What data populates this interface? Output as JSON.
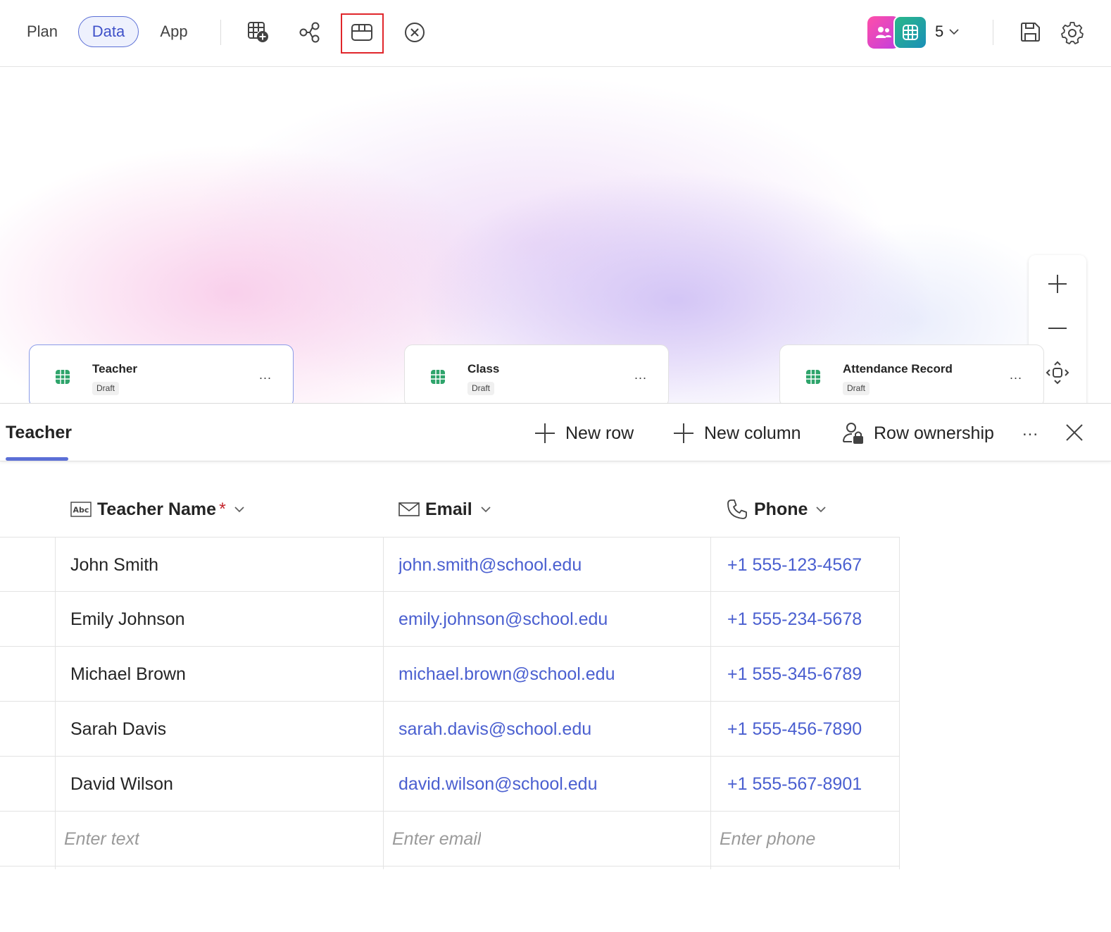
{
  "nav": {
    "tabs": [
      "Plan",
      "Data",
      "App"
    ],
    "active": "Data"
  },
  "toolbar": {
    "icons": [
      "add-table-icon",
      "relationships-icon",
      "table-view-icon",
      "close-circle-icon"
    ],
    "highlighted": "table-view-icon"
  },
  "collaborators": {
    "count": "5"
  },
  "colors": {
    "accent": "#5b6fd6",
    "link": "#4a5fd0",
    "highlight": "#e0262b",
    "required": "#c4262e",
    "table_icon": "#2ea46b"
  },
  "canvas": {
    "tables": [
      {
        "name": "Teacher",
        "status": "Draft"
      },
      {
        "name": "Class",
        "status": "Draft"
      },
      {
        "name": "Attendance Record",
        "status": "Draft"
      }
    ],
    "more_label": "..."
  },
  "panel": {
    "title": "Teacher",
    "actions": {
      "new_row": "New row",
      "new_column": "New column",
      "row_ownership": "Row ownership"
    },
    "more_label": "..."
  },
  "table": {
    "columns": [
      {
        "label": "Teacher Name",
        "required_mark": "*",
        "type_icon": "text-type-icon"
      },
      {
        "label": "Email",
        "type_icon": "mail-icon"
      },
      {
        "label": "Phone",
        "type_icon": "phone-icon"
      }
    ],
    "rows": [
      {
        "name": "John Smith",
        "email": "john.smith@school.edu",
        "phone": "+1 555-123-4567"
      },
      {
        "name": "Emily Johnson",
        "email": "emily.johnson@school.edu",
        "phone": "+1 555-234-5678"
      },
      {
        "name": "Michael Brown",
        "email": "michael.brown@school.edu",
        "phone": "+1 555-345-6789"
      },
      {
        "name": "Sarah Davis",
        "email": "sarah.davis@school.edu",
        "phone": "+1 555-456-7890"
      },
      {
        "name": "David Wilson",
        "email": "david.wilson@school.edu",
        "phone": "+1 555-567-8901"
      }
    ],
    "placeholders": {
      "name": "Enter text",
      "email": "Enter email",
      "phone": "Enter phone"
    }
  }
}
